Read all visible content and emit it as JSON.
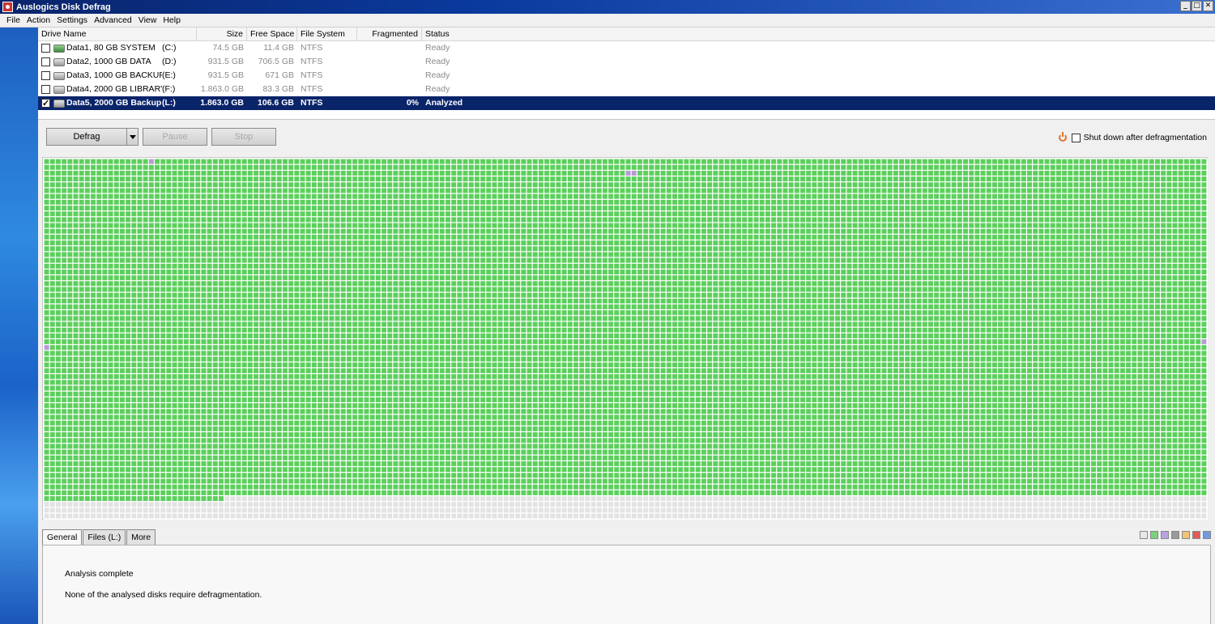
{
  "window": {
    "title": "Auslogics Disk Defrag",
    "controls": [
      "_",
      "□",
      "✕"
    ]
  },
  "menu": [
    "File",
    "Action",
    "Settings",
    "Advanced",
    "View",
    "Help"
  ],
  "drive_list": {
    "columns": {
      "name": "Drive Name",
      "size": "Size",
      "free": "Free Space",
      "fs": "File System",
      "frag": "Fragmented",
      "status": "Status"
    },
    "rows": [
      {
        "name": "Data1,  80 GB SYSTEM",
        "letter": "(C:)",
        "size": "74.5 GB",
        "free": "11.4 GB",
        "fs": "NTFS",
        "frag": "",
        "status": "Ready",
        "checked": false,
        "selected": false,
        "icon": "system-drive-icon"
      },
      {
        "name": "Data2, 1000 GB  DATA",
        "letter": "(D:)",
        "size": "931.5 GB",
        "free": "706.5 GB",
        "fs": "NTFS",
        "frag": "",
        "status": "Ready",
        "checked": false,
        "selected": false,
        "icon": "hard-drive-icon"
      },
      {
        "name": "Data3, 1000 GB BACKUP",
        "letter": "(E:)",
        "size": "931.5 GB",
        "free": "671 GB",
        "fs": "NTFS",
        "frag": "",
        "status": "Ready",
        "checked": false,
        "selected": false,
        "icon": "hard-drive-icon"
      },
      {
        "name": "Data4, 2000 GB LIBRARY",
        "letter": "(F:)",
        "size": "1.863.0 GB",
        "free": "83.3 GB",
        "fs": "NTFS",
        "frag": "",
        "status": "Ready",
        "checked": false,
        "selected": false,
        "icon": "hard-drive-icon"
      },
      {
        "name": "Data5, 2000 GB Backup",
        "letter": "(L:)",
        "size": "1.863.0 GB",
        "free": "106.6 GB",
        "fs": "NTFS",
        "frag": "0%",
        "status": "Analyzed",
        "checked": true,
        "selected": true,
        "icon": "hard-drive-icon"
      }
    ]
  },
  "toolbar": {
    "defrag_label": "Defrag",
    "pause_label": "Pause",
    "stop_label": "Stop",
    "shutdown_label": "Shut down after defragmentation"
  },
  "cluster_map": {
    "colors": {
      "used": "#5ccf5c",
      "free": "#e3e3e3",
      "fragmented": "#b79ad6",
      "grid": "#ffffff"
    },
    "used_fraction": 0.938
  },
  "tabs": [
    "General",
    "Files (L:)",
    "More"
  ],
  "legend_colors": [
    "#e8e8e8",
    "#7bd17b",
    "#b9a4e0",
    "#9a9a9a",
    "#f0c27a",
    "#e05a5a",
    "#6f9ae0"
  ],
  "info": {
    "line1": "Analysis complete",
    "line2": "None of the analysed disks require defragmentation."
  }
}
